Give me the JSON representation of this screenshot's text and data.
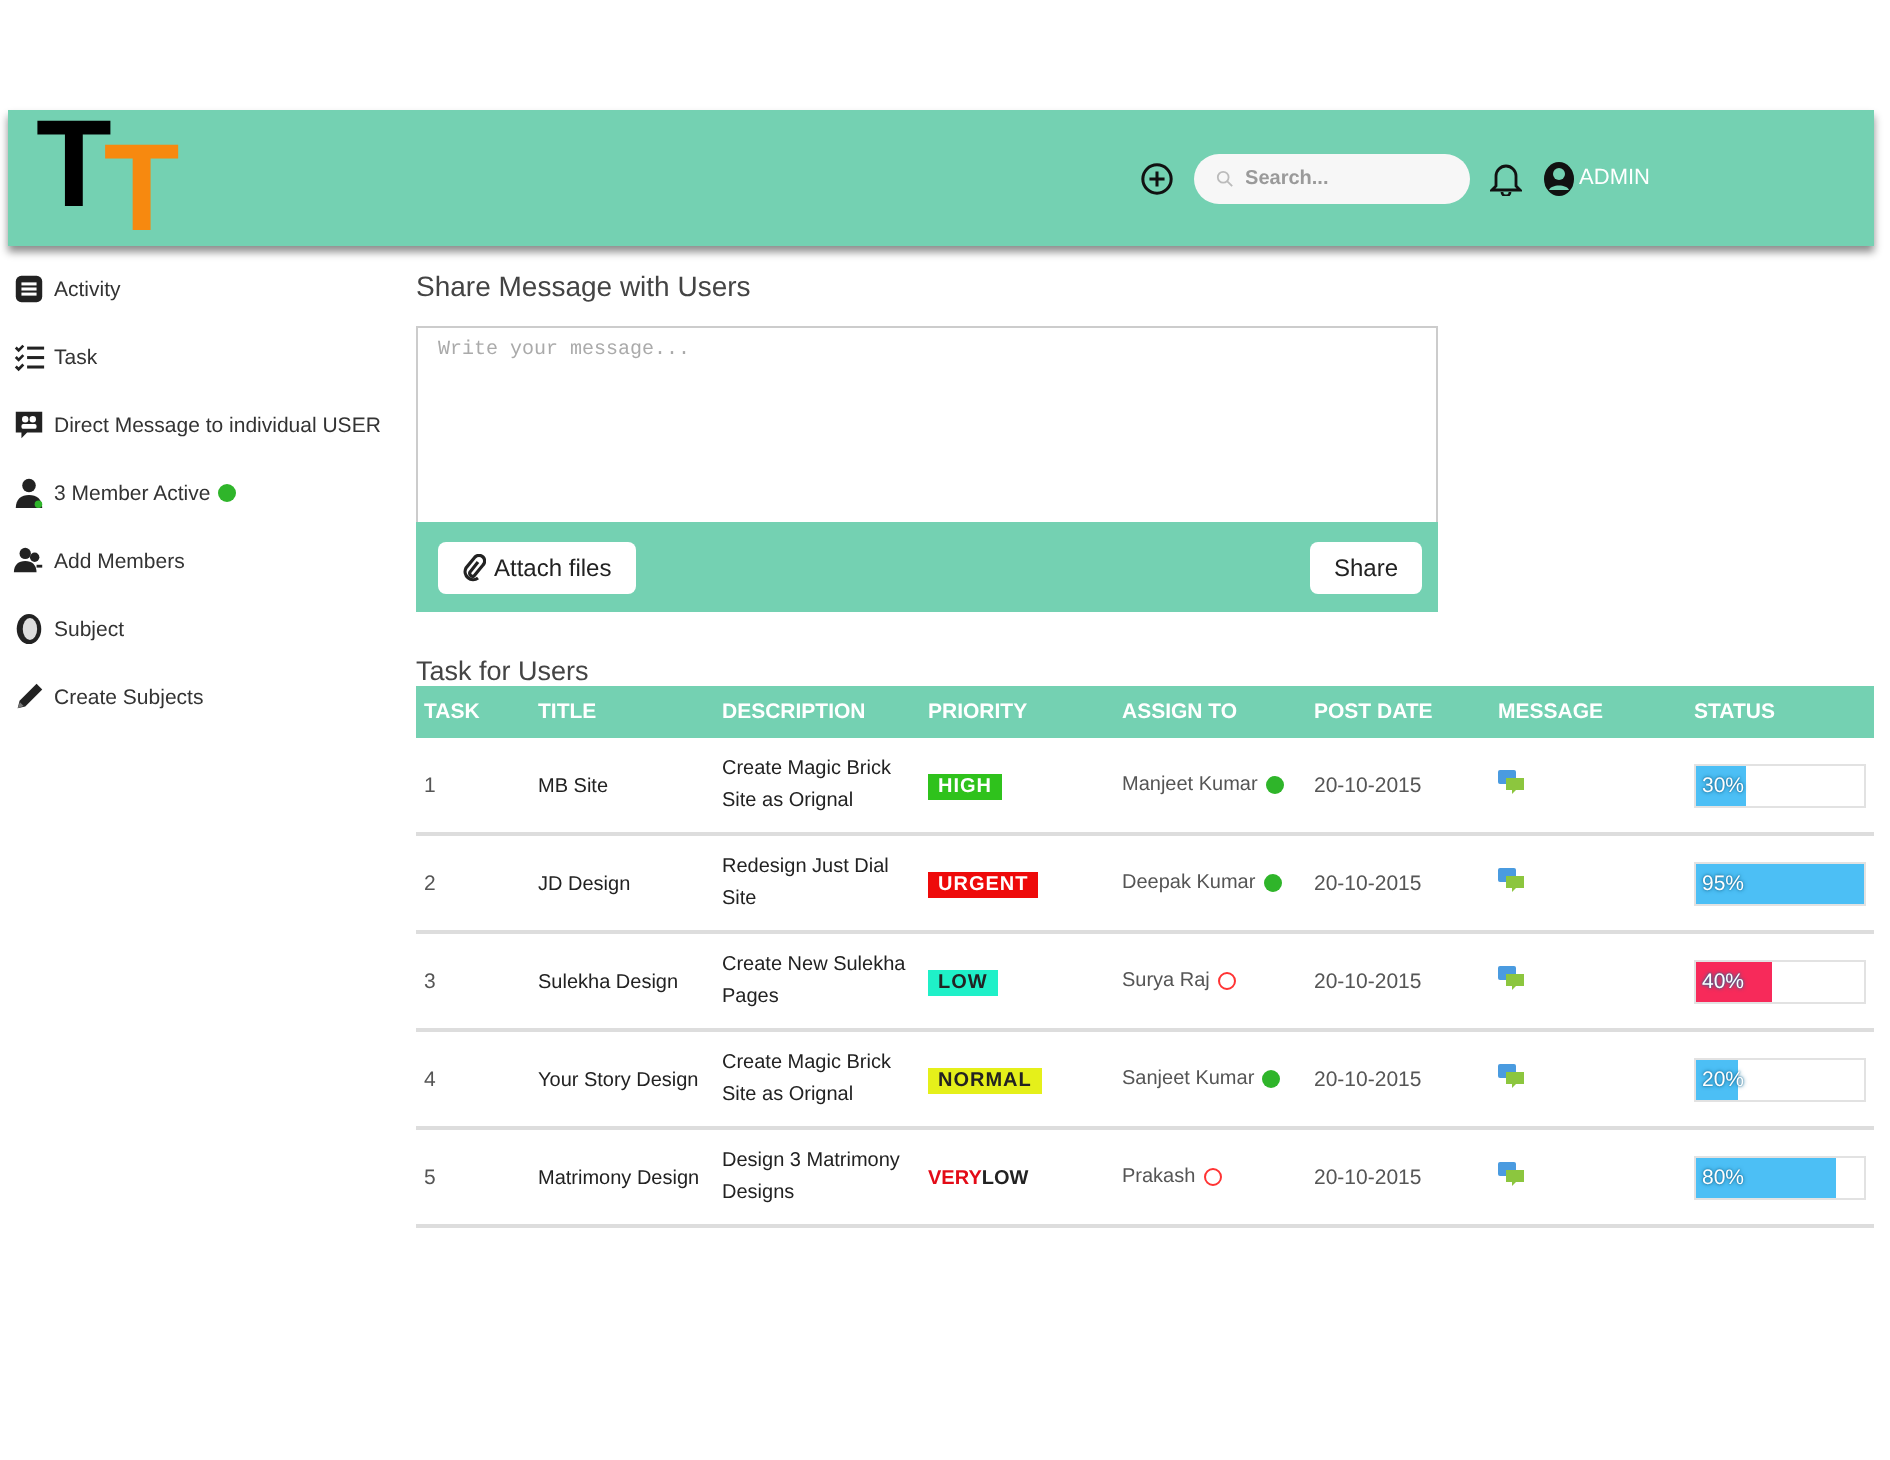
{
  "header": {
    "logo": [
      {
        "text": "T",
        "color": "#000000"
      },
      {
        "text": "T",
        "color": "#f7890f"
      }
    ],
    "search": {
      "placeholder": "Search..."
    },
    "user": "ADMIN"
  },
  "sidebar": {
    "items": [
      {
        "kind": "list",
        "label": "Activity"
      },
      {
        "kind": "checklist",
        "label": "Task"
      },
      {
        "kind": "chat",
        "label": "Direct Message to individual USER"
      },
      {
        "kind": "user",
        "label": "3 Member Active",
        "online": true
      },
      {
        "kind": "users",
        "label": "Add Members"
      },
      {
        "kind": "book",
        "label": "Subject"
      },
      {
        "kind": "pencil",
        "label": "Create Subjects"
      }
    ]
  },
  "share": {
    "title": "Share Message with Users",
    "placeholder": "Write your message...",
    "attach": "Attach files",
    "button": "Share"
  },
  "tasks": {
    "title": "Task for Users",
    "columns": [
      "TASK",
      "TITLE",
      "DESCRIPTION",
      "PRIORITY",
      "ASSIGN TO",
      "POST DATE",
      "MESSAGE",
      "STATUS"
    ],
    "rows": [
      {
        "task": "1",
        "title": "MB Site",
        "description": "Create Magic Brick Site as Orignal",
        "priority": {
          "kind": "badge",
          "label": "HIGH",
          "color": "#2fc21c"
        },
        "assignee": "Manjeet Kumar",
        "online": true,
        "date": "20-10-2015",
        "status": {
          "text": "30%",
          "level": 0.3,
          "color": "#4cbff5"
        }
      },
      {
        "task": "2",
        "title": "JD Design",
        "description": "Redesign Just Dial Site",
        "priority": {
          "kind": "badge",
          "label": "URGENT",
          "color": "#ee0a0a"
        },
        "assignee": "Deepak Kumar",
        "online": true,
        "date": "20-10-2015",
        "status": {
          "text": "95%",
          "level": 1.0,
          "color": "#4cbff5"
        }
      },
      {
        "task": "3",
        "title": "Sulekha Design",
        "description": "Create New Sulekha Pages",
        "priority": {
          "kind": "badge",
          "label": "LOW",
          "color": "#1ff0c8"
        },
        "assignee": "Surya Raj",
        "online": false,
        "date": "20-10-2015",
        "status": {
          "text": "40%",
          "level": 0.45,
          "color": "#f72a5a"
        }
      },
      {
        "task": "4",
        "title": "Your Story Design",
        "description": "Create Magic Brick Site as Orignal",
        "priority": {
          "kind": "badge",
          "label": "NORMAL",
          "color": "#e5f01a"
        },
        "assignee": "Sanjeet Kumar",
        "online": true,
        "date": "20-10-2015",
        "status": {
          "text": "20%",
          "level": 0.25,
          "color": "#4cbff5"
        }
      },
      {
        "task": "5",
        "title": "Matrimony Design",
        "description": "Design 3 Matrimony Designs",
        "priority": {
          "kind": "split",
          "parts": [
            {
              "text": "VERY",
              "color": "#e30b17"
            },
            {
              "text": "LOW",
              "color": "#222222"
            }
          ]
        },
        "assignee": "Prakash",
        "online": false,
        "date": "20-10-2015",
        "status": {
          "text": "80%",
          "level": 0.83,
          "color": "#4cbff5"
        }
      }
    ]
  }
}
